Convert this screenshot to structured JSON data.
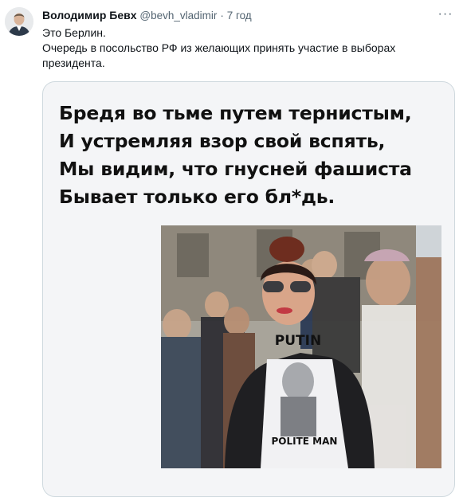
{
  "tweet": {
    "author": {
      "display_name": "Володимир Бевх",
      "handle": "@bevh_vladimir",
      "separator": "·",
      "time": "7 год"
    },
    "more_icon": "more-dots-icon",
    "text_lines": [
      "Это Берлин.",
      "Очередь в посольство РФ из желающих принять участие в выборах президента."
    ],
    "media": {
      "poem_lines": [
        "Бредя во тьме путем тернистым,",
        "И устремляя взор свой вспять,",
        "Мы видим, что гнусней фашиста",
        "Бывает только его бл*дь."
      ],
      "shirt_text_top": "PUTIN",
      "shirt_text_bottom": "POLITE MAN"
    }
  },
  "colors": {
    "text": "#0f1419",
    "secondary": "#536471",
    "card_border": "#cfd9de",
    "card_bg": "#f4f5f7"
  }
}
